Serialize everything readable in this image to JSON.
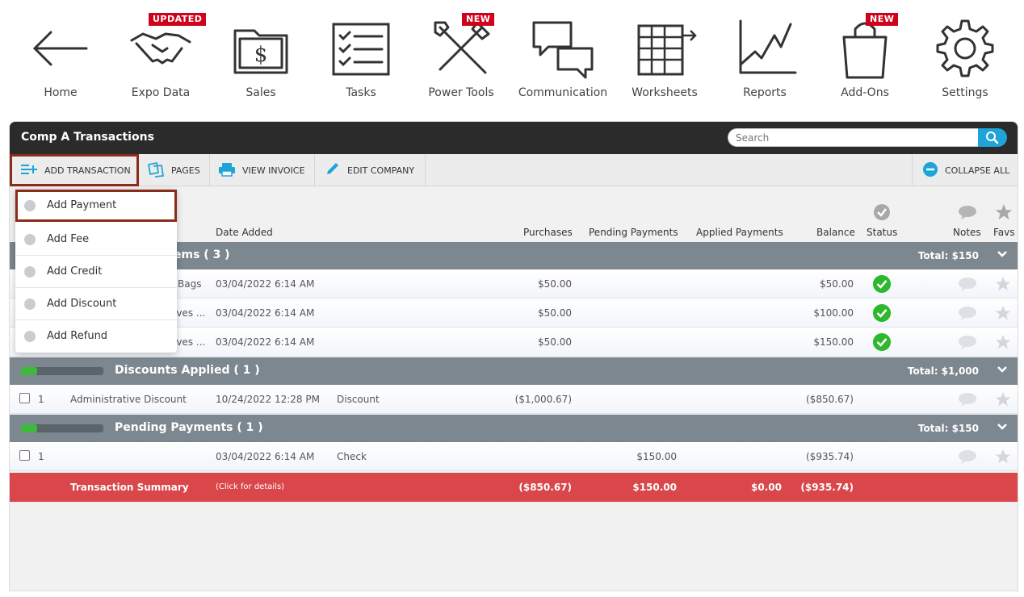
{
  "nav": {
    "items": [
      {
        "label": "Home",
        "icon": "arrow-left-icon",
        "badge": ""
      },
      {
        "label": "Expo Data",
        "icon": "handshake-icon",
        "badge": "UPDATED"
      },
      {
        "label": "Sales",
        "icon": "dollar-folder-icon",
        "badge": ""
      },
      {
        "label": "Tasks",
        "icon": "checklist-icon",
        "badge": ""
      },
      {
        "label": "Power Tools",
        "icon": "wrench-hammer-icon",
        "badge": "NEW"
      },
      {
        "label": "Communication",
        "icon": "speech-bubbles-icon",
        "badge": ""
      },
      {
        "label": "Worksheets",
        "icon": "spreadsheet-icon",
        "badge": ""
      },
      {
        "label": "Reports",
        "icon": "line-chart-icon",
        "badge": ""
      },
      {
        "label": "Add-Ons",
        "icon": "shopping-bag-icon",
        "badge": "NEW"
      },
      {
        "label": "Settings",
        "icon": "gear-icon",
        "badge": ""
      }
    ]
  },
  "panel": {
    "title": "Comp A Transactions",
    "search_placeholder": "Search"
  },
  "toolbar": {
    "add_transaction": "ADD TRANSACTION",
    "pages": "PAGES",
    "view_invoice": "VIEW INVOICE",
    "edit_company": "EDIT COMPANY",
    "collapse_all": "COLLAPSE ALL"
  },
  "columns": {
    "date_added": "Date Added",
    "purchases": "Purchases",
    "pending_payments": "Pending Payments",
    "applied_payments": "Applied Payments",
    "balance": "Balance",
    "status": "Status",
    "notes": "Notes",
    "favs": "Favs"
  },
  "groups": {
    "items": {
      "title_visible": "ems  ( 3 )",
      "total": "Total:  $150"
    },
    "discounts": {
      "title": "Discounts Applied  ( 1 )",
      "total": "Total:  $1,000",
      "progress": 0.2
    },
    "pending": {
      "title": "Pending Payments  ( 1 )",
      "total": "Total:  $150",
      "progress": 0.2
    }
  },
  "item_rows": [
    {
      "desc": "Bags",
      "date": "03/04/2022 6:14 AM",
      "purchases": "$50.00",
      "balance": "$50.00"
    },
    {
      "desc": "lves ...",
      "date": "03/04/2022 6:14 AM",
      "purchases": "$50.00",
      "balance": "$100.00"
    },
    {
      "desc": "lves ...",
      "date": "03/04/2022 6:14 AM",
      "purchases": "$50.00",
      "balance": "$150.00"
    }
  ],
  "discount_rows": [
    {
      "num": "1",
      "desc": "Administrative Discount",
      "date": "10/24/2022 12:28 PM",
      "type": "Discount",
      "purchases": "($1,000.67)",
      "balance": "($850.67)"
    }
  ],
  "pending_rows": [
    {
      "num": "1",
      "date": "03/04/2022 6:14 AM",
      "type": "Check",
      "pending": "$150.00",
      "balance": "($935.74)"
    }
  ],
  "summary": {
    "label": "Transaction Summary",
    "hint": "(Click for details)",
    "purchases": "($850.67)",
    "pending": "$150.00",
    "applied": "$0.00",
    "balance": "($935.74)"
  },
  "dropdown": {
    "items": [
      "Add Payment",
      "Add Fee",
      "Add Credit",
      "Add Discount",
      "Add Refund"
    ]
  },
  "colors": {
    "header_dark": "#2b2b2b",
    "accent_blue": "#1fa4d9",
    "group_bar": "#7d8790",
    "summary_red": "#d9474a",
    "status_green": "#2eb82e",
    "badge_red": "#d0021b",
    "highlight_border": "#8b2c1b"
  }
}
